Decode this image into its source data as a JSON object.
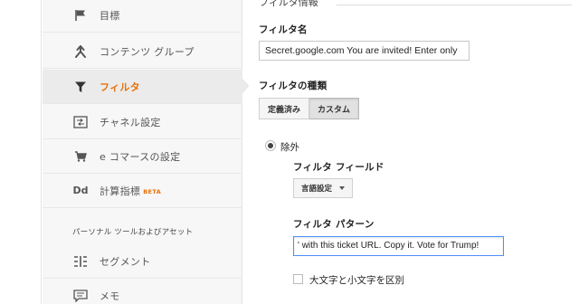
{
  "sidebar": {
    "items": [
      {
        "label": "目標",
        "icon": "flag-icon"
      },
      {
        "label": "コンテンツ グループ",
        "icon": "content-group-icon"
      },
      {
        "label": "フィルタ",
        "icon": "filter-icon",
        "active": true
      },
      {
        "label": "チャネル設定",
        "icon": "channel-settings-icon"
      },
      {
        "label": "e コマースの設定",
        "icon": "cart-icon"
      },
      {
        "label": "計算指標",
        "badge": "BETA",
        "icon": "calculated-metrics-icon"
      }
    ],
    "section_header": "パーソナル ツールおよびアセット",
    "section_items": [
      {
        "label": "セグメント",
        "icon": "segments-icon"
      },
      {
        "label": "メモ",
        "icon": "annotations-icon"
      }
    ]
  },
  "form": {
    "legend": "フィルタ情報",
    "filter_name_label": "フィルタ名",
    "filter_name_value": "Secret.google.com You are invited! Enter only",
    "filter_type_label": "フィルタの種類",
    "type_tabs": [
      {
        "label": "定義済み",
        "selected": false
      },
      {
        "label": "カスタム",
        "selected": true
      }
    ],
    "exclude_label": "除外",
    "filter_field_label": "フィルタ フィールド",
    "filter_field_value": "言語設定",
    "filter_pattern_label": "フィルタ パターン",
    "filter_pattern_value": "' with this ticket URL. Copy it. Vote for Trump!",
    "case_sensitive_label": "大文字と小文字を区別"
  },
  "colors": {
    "accent_orange": "#e8710a",
    "focus_blue": "#4d90fe",
    "sidebar_bg": "#f7f7f7"
  }
}
